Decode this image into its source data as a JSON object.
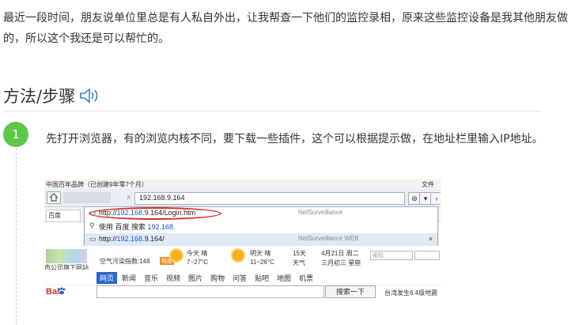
{
  "article": {
    "intro": "最近一段时间，朋友说单位里总是有人私自外出，让我帮查一下他们的监控录相，原来这些监控设备是我其他朋友做的，所以这个我还是可以帮忙的。",
    "section_title": "方法/步骤",
    "step": {
      "number": "1",
      "text": "先打开浏览器，有的浏览内核不同，要下载一些插件，这个可以根据提示做，在地址栏里输入IP地址。"
    }
  },
  "screenshot": {
    "top_left": "中国百年品牌（已创建9年零7个月）",
    "top_right": "文件",
    "url_value": "192.168.9.164",
    "tab_label": "百度",
    "dropdown": [
      {
        "url_prefix": "http://",
        "url_bold": "192.168.",
        "url_suffix": "9.164/Login.htm",
        "title": "NetSurveillance"
      },
      {
        "label": "使用 百度 搜索",
        "query": "192.168."
      },
      {
        "url_prefix": "http://",
        "url_bold": "192.168.",
        "url_suffix": "9.164/",
        "title": "NetSurveillance WEB"
      }
    ],
    "weather": {
      "air": "空气污染指数:148",
      "air_badge": "轻度",
      "today_label": "今天 晴",
      "today_temp": "7~27°C",
      "tomorrow_label": "明天 晴",
      "tomorrow_temp": "11~26°C",
      "days": "15天",
      "forecast": "天气",
      "date": "4月21日 周二",
      "lunar": "三月初三 星座",
      "pwd_placeholder": "密码",
      "city_note": "市公司旗下网站"
    },
    "nav": [
      "网页",
      "新闻",
      "音乐",
      "视频",
      "图片",
      "购物",
      "问答",
      "贴吧",
      "地图",
      "机票"
    ],
    "search_button": "搜索一下",
    "news": "台湾发生6.4级地震"
  },
  "colors": {
    "step_green": "#5fc84a",
    "link_blue": "#1a56c4",
    "highlight_red": "#d9322b"
  }
}
